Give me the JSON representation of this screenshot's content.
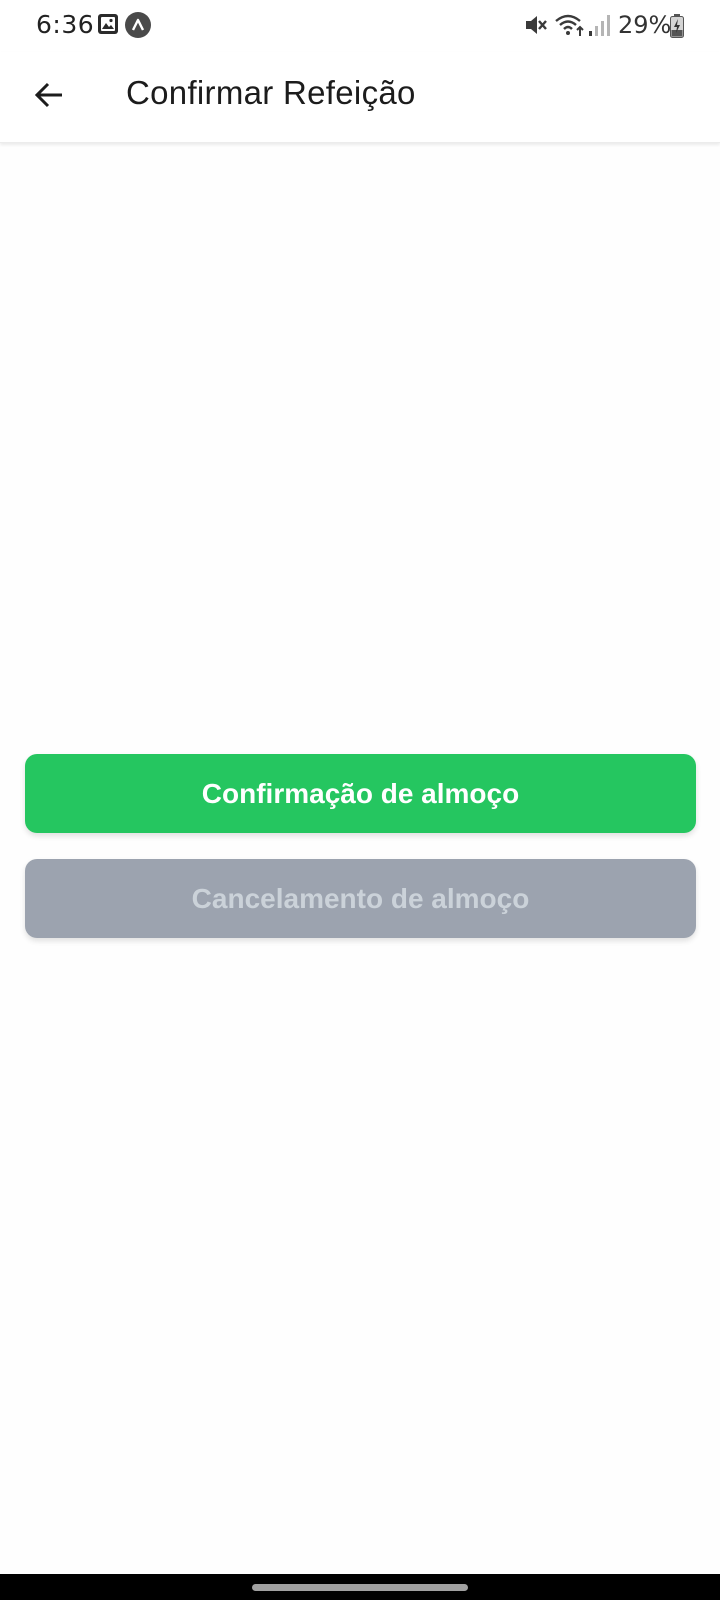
{
  "status_bar": {
    "time": "6:36",
    "battery": "29%",
    "icons": [
      "gallery-icon",
      "app-notification-icon",
      "mute-icon",
      "wifi-icon",
      "signal-icon",
      "battery-icon"
    ]
  },
  "app_bar": {
    "title": "Confirmar Refeição",
    "back_icon": "arrow-left-icon"
  },
  "actions": {
    "confirm_label": "Confirmação de almoço",
    "cancel_label": "Cancelamento de almoço"
  },
  "colors": {
    "confirm_bg": "#25c660",
    "cancel_bg": "#9ca3af",
    "cancel_text": "#cbd2d9"
  }
}
